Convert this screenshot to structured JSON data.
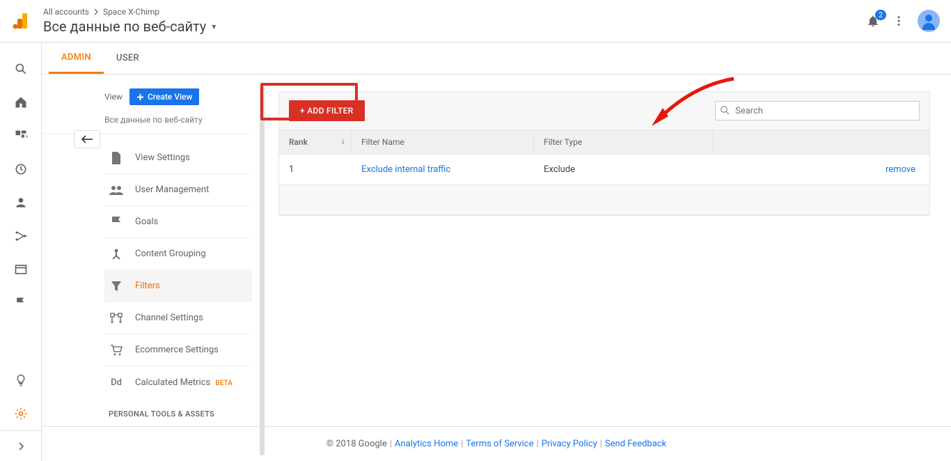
{
  "header": {
    "breadcrumb_root": "All accounts",
    "breadcrumb_leaf": "Space X-Chimp",
    "property_title": "Все данные по веб-сайту",
    "notif_count": "2"
  },
  "tabs": {
    "admin": "ADMIN",
    "user": "USER"
  },
  "view_panel": {
    "label": "View",
    "create_button": "Create View",
    "subtitle": "Все данные по веб-сайту"
  },
  "menu": {
    "view_settings": "View Settings",
    "user_management": "User Management",
    "goals": "Goals",
    "content_grouping": "Content Grouping",
    "filters": "Filters",
    "channel_settings": "Channel Settings",
    "ecommerce_settings": "Ecommerce Settings",
    "calculated_metrics": "Calculated Metrics",
    "calculated_metrics_badge": "BETA",
    "section_personal": "PERSONAL TOOLS & ASSETS",
    "dd_icon_text": "Dd"
  },
  "content": {
    "add_filter_button": "+ ADD FILTER",
    "search_placeholder": "Search",
    "columns": {
      "rank": "Rank",
      "filter_name": "Filter Name",
      "filter_type": "Filter Type"
    },
    "rows": [
      {
        "rank": "1",
        "name": "Exclude internal traffic",
        "type": "Exclude",
        "action": "remove"
      }
    ]
  },
  "footer": {
    "copyright": "© 2018 Google",
    "links": {
      "analytics_home": "Analytics Home",
      "terms": "Terms of Service",
      "privacy": "Privacy Policy",
      "feedback": "Send Feedback"
    }
  }
}
